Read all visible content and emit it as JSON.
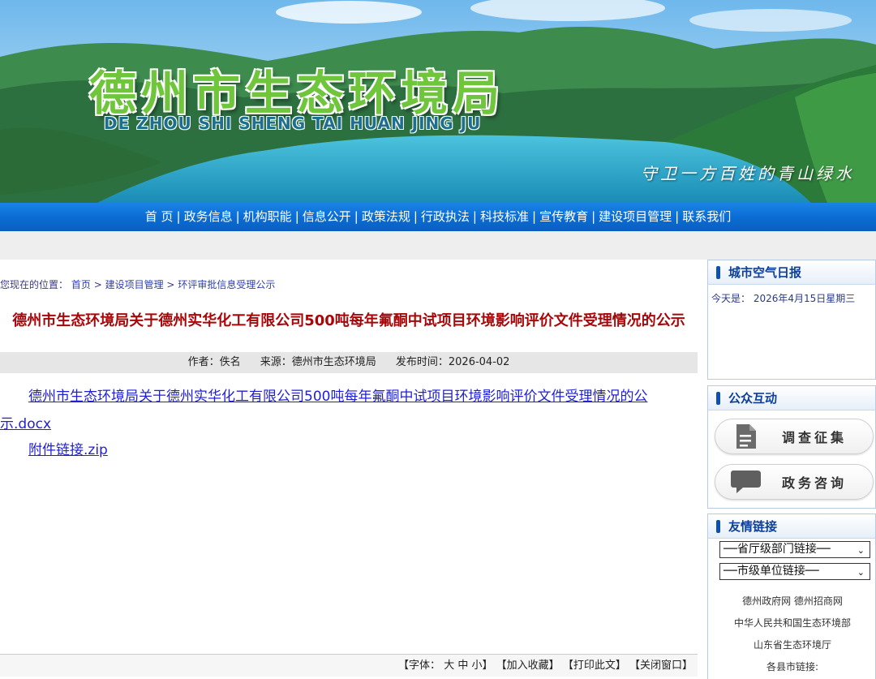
{
  "header": {
    "title": "德州市生态环境局",
    "subtitle": "DE ZHOU SHI SHENG TAI HUAN JING JU",
    "slogan": "守卫一方百姓的青山绿水"
  },
  "nav": {
    "items": [
      "首 页",
      "政务信息",
      "机构职能",
      "信息公开",
      "政策法规",
      "行政执法",
      "科技标准",
      "宣传教育",
      "建设项目管理",
      "联系我们"
    ],
    "separator": "|"
  },
  "breadcrumb": {
    "prefix": "您现在的位置：",
    "home": "首页",
    "arrow": ">",
    "level1": "建设项目管理",
    "level2": "环评审批信息受理公示"
  },
  "article": {
    "title": "德州市生态环境局关于德州实华化工有限公司500吨每年氟酮中试项目环境影响评价文件受理情况的公示",
    "author": "作者：佚名",
    "source": "来源：德州市生态环境局",
    "published": "发布时间：2026-04-02",
    "attachment_docx": "德州市生态环境局关于德州实华化工有限公司500吨每年氟酮中试项目环境影响评价文件受理情况的公示.docx",
    "attachment_zip": "附件链接.zip"
  },
  "toolbar": {
    "font_open": "【字体：",
    "font_large": "大",
    "font_medium": "中",
    "font_small": "小",
    "font_close": "】",
    "bookmark": "【加入收藏】",
    "print": "【打印此文】",
    "close": "【关闭窗口】"
  },
  "sidebar": {
    "air": {
      "heading": "城市空气日报",
      "date": "今天是： 2026年4月15日星期三"
    },
    "interaction": {
      "heading": "公众互动",
      "survey": "调查征集",
      "consult": "政务咨询"
    },
    "links": {
      "heading": "友情链接",
      "select_province": "──省厅级部门链接──",
      "select_city": "──市级单位链接──",
      "link_row1": [
        "德州政府网",
        "德州招商网"
      ],
      "link_row2": "中华人民共和国生态环境部",
      "link_row3": "山东省生态环境厅",
      "link_row4": "各县市链接:"
    }
  },
  "colors": {
    "nav_blue": "#0b6dd4",
    "title_red": "#a8070a",
    "link_blue": "#1f1fd6",
    "sidebar_heading": "#0d3f99"
  }
}
